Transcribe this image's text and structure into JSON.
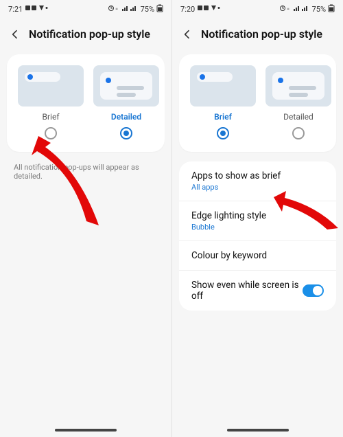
{
  "left": {
    "status": {
      "time": "7:21",
      "battery": "75%"
    },
    "header": {
      "title": "Notification pop-up style"
    },
    "options": {
      "brief": {
        "label": "Brief",
        "selected": false
      },
      "detailed": {
        "label": "Detailed",
        "selected": true
      }
    },
    "hint": "All notification pop-ups will appear as detailed."
  },
  "right": {
    "status": {
      "time": "7:20",
      "battery": "75%"
    },
    "header": {
      "title": "Notification pop-up style"
    },
    "options": {
      "brief": {
        "label": "Brief",
        "selected": true
      },
      "detailed": {
        "label": "Detailed",
        "selected": false
      }
    },
    "rows": {
      "apps": {
        "title": "Apps to show as brief",
        "sub": "All apps"
      },
      "edge": {
        "title": "Edge lighting style",
        "sub": "Bubble"
      },
      "colour": {
        "title": "Colour by keyword"
      },
      "showoff": {
        "title": "Show even while screen is off",
        "toggle": true
      }
    }
  }
}
